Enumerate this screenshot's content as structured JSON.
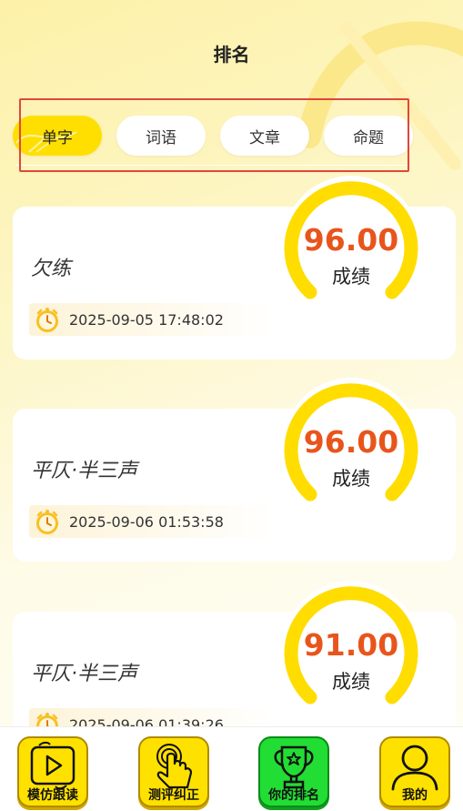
{
  "header": {
    "title": "排名"
  },
  "tabs": [
    {
      "label": "单字",
      "active": true
    },
    {
      "label": "词语",
      "active": false
    },
    {
      "label": "文章",
      "active": false
    },
    {
      "label": "命题",
      "active": false
    }
  ],
  "cards": [
    {
      "word": "欠练",
      "time": "2025-09-05 17:48:02",
      "score": "96.00",
      "score_label": "成绩"
    },
    {
      "word": "平仄·半三声",
      "time": "2025-09-06 01:53:58",
      "score": "96.00",
      "score_label": "成绩"
    },
    {
      "word": "平仄·半三声",
      "time": "2025-09-06 01:39:26",
      "score": "91.00",
      "score_label": "成绩"
    }
  ],
  "bottom_nav": [
    {
      "label": "模仿跟读",
      "icon": "play-video-icon"
    },
    {
      "label": "测评纠正",
      "icon": "touch-hand-icon"
    },
    {
      "label": "你的排名",
      "icon": "trophy-icon",
      "active": true
    },
    {
      "label": "我的",
      "icon": "user-icon"
    }
  ],
  "colors": {
    "accent": "#ffdf00",
    "score": "#e8551c",
    "active_nav": "#22dd33",
    "highlight_box": "#e0463f"
  }
}
